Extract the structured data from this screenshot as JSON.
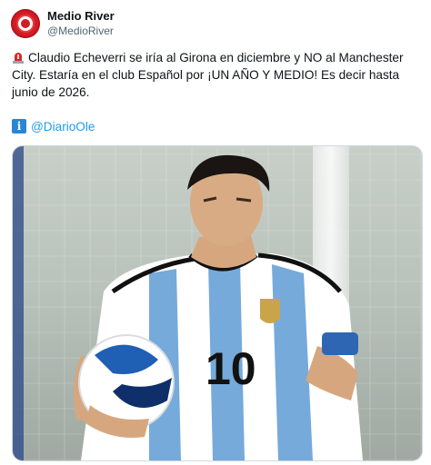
{
  "account": {
    "display_name": "Medio River",
    "handle": "@MedioRiver"
  },
  "tweet": {
    "body": "Claudio Echeverri se iría al Girona en diciembre y NO al Manchester City. Estaría en el club Español por ¡UN AÑO Y MEDIO! Es decir hasta junio de 2026.",
    "siren_icon": "rotating-light-emoji",
    "info_icon": "information-emoji",
    "source_mention": "@DiarioOle"
  },
  "media": {
    "jersey_number": "10",
    "colors": {
      "jersey_sky_blue": "#75aadb",
      "jersey_white": "#ffffff",
      "ball_blue": "#1f5fb4",
      "avatar_red": "#d41c24",
      "link_blue": "#1d9bf0"
    }
  }
}
